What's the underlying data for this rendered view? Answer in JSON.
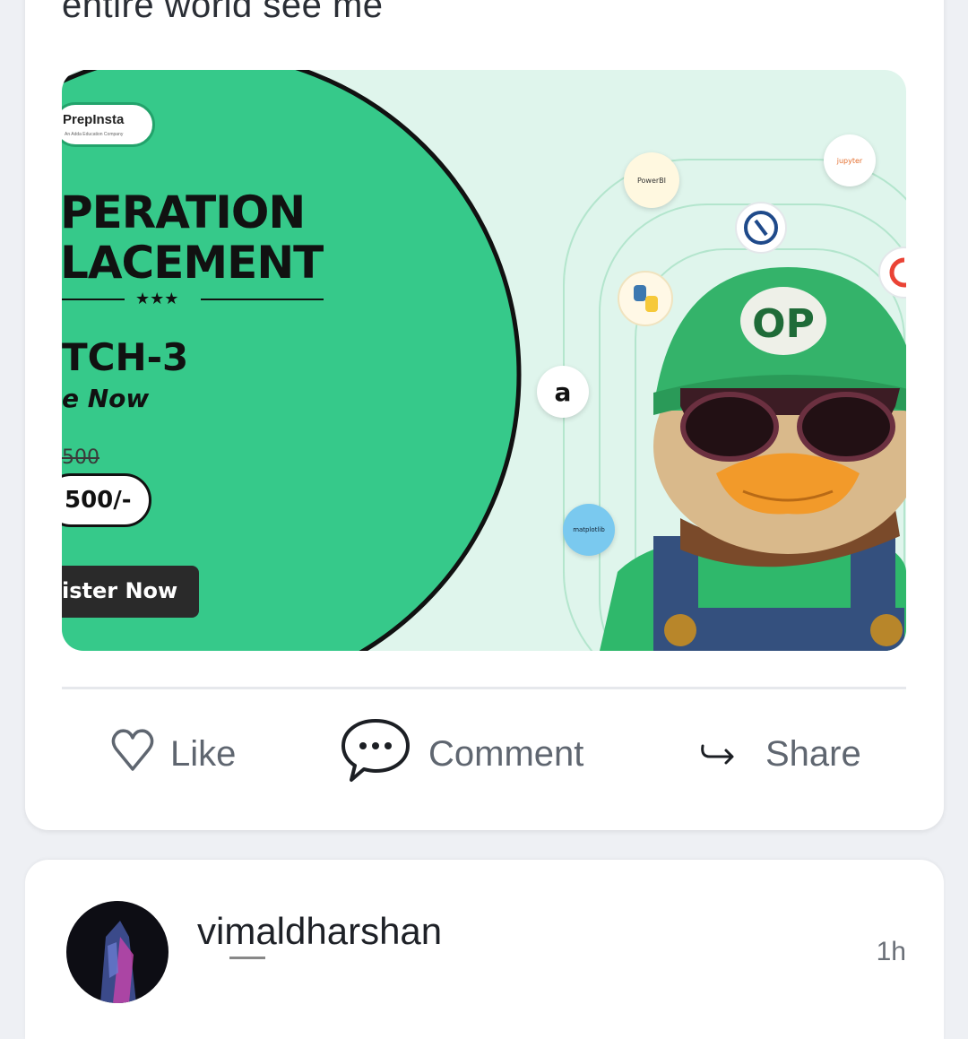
{
  "post": {
    "caption": "entire world see me",
    "banner": {
      "logo": "PrepInsta",
      "logo_sub": "An Adda Education Company",
      "title_line1": "PERATION",
      "title_line2": "LACEMENT",
      "stars": "★★★",
      "batch": "TCH-3",
      "cta_line": "e Now",
      "old_price": "500",
      "new_price": "500/-",
      "register": "ister Now",
      "mascot_cap": "OP",
      "tech_labels": {
        "powerbi": "PowerBI",
        "jupyter": "jupyter",
        "matplotlib": "matplotlib",
        "amazon": "a"
      }
    },
    "actions": {
      "like": "Like",
      "comment": "Comment",
      "share": "Share"
    }
  },
  "next_post": {
    "username": "vimaldharshan",
    "time": "1h"
  },
  "colors": {
    "banner_green": "#36c98a",
    "banner_bg": "#dff5ec",
    "action_gray": "#5f6670",
    "card_bg": "#ffffff",
    "page_bg": "#eef0f4"
  }
}
